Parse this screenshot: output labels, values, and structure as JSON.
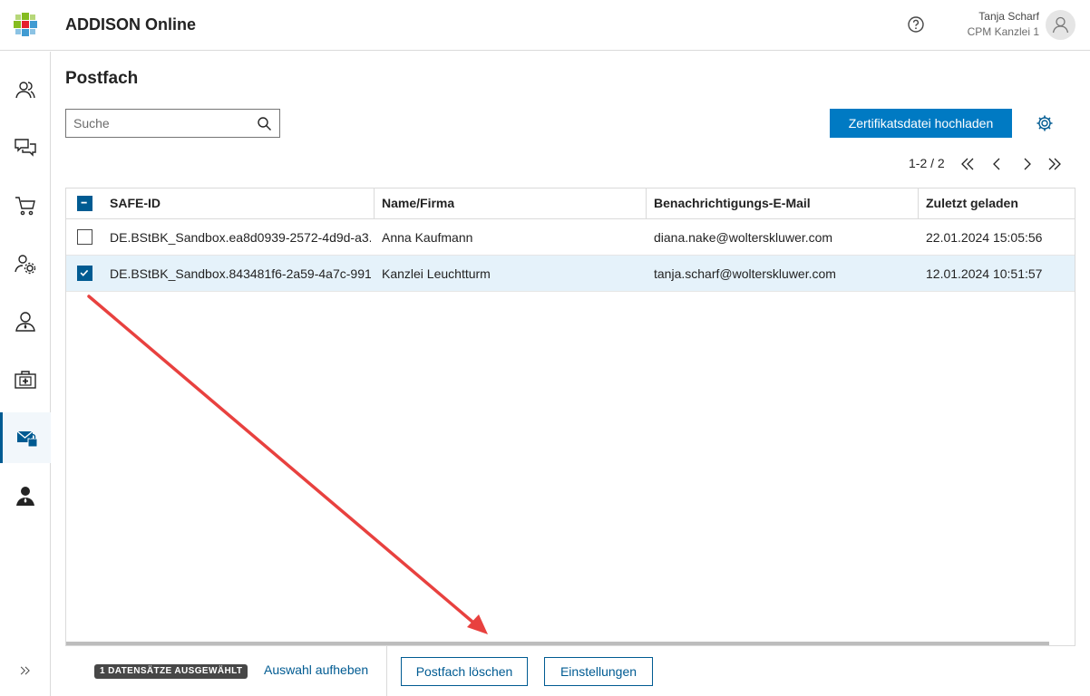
{
  "header": {
    "app_title": "ADDISON Online",
    "user_name": "Tanja Scharf",
    "user_org": "CPM Kanzlei 1"
  },
  "sidebar": {
    "items": [
      {
        "icon": "users-icon"
      },
      {
        "icon": "chat-icon"
      },
      {
        "icon": "cart-icon"
      },
      {
        "icon": "user-settings-icon"
      },
      {
        "icon": "person-icon"
      },
      {
        "icon": "medical-kit-icon"
      },
      {
        "icon": "mailbox-icon",
        "active": true
      },
      {
        "icon": "admin-person-icon"
      }
    ],
    "expand_icon": "double-chevron-right-icon"
  },
  "main": {
    "title": "Postfach",
    "search_placeholder": "Suche",
    "upload_button": "Zertifikatsdatei hochladen",
    "pager_text": "1-2 / 2"
  },
  "table": {
    "columns": [
      "SAFE-ID",
      "Name/Firma",
      "Benachrichtigungs-E-Mail",
      "Zuletzt geladen"
    ],
    "rows": [
      {
        "safe_id": "DE.BStBK_Sandbox.ea8d0939-2572-4d9d-a3...",
        "name": "Anna Kaufmann",
        "email": "diana.nake@wolterskluwer.com",
        "loaded": "22.01.2024 15:05:56",
        "selected": false
      },
      {
        "safe_id": "DE.BStBK_Sandbox.843481f6-2a59-4a7c-991...",
        "name": "Kanzlei Leuchtturm",
        "email": "tanja.scharf@wolterskluwer.com",
        "loaded": "12.01.2024 10:51:57",
        "selected": true
      }
    ]
  },
  "footer": {
    "selection_badge": "1 DATENSÄTZE AUSGEWÄHLT",
    "deselect_link": "Auswahl aufheben",
    "delete_button": "Postfach löschen",
    "settings_button": "Einstellungen"
  },
  "colors": {
    "primary": "#007ac3",
    "dark_blue": "#005b92",
    "annotation_arrow": "#e8413f"
  }
}
